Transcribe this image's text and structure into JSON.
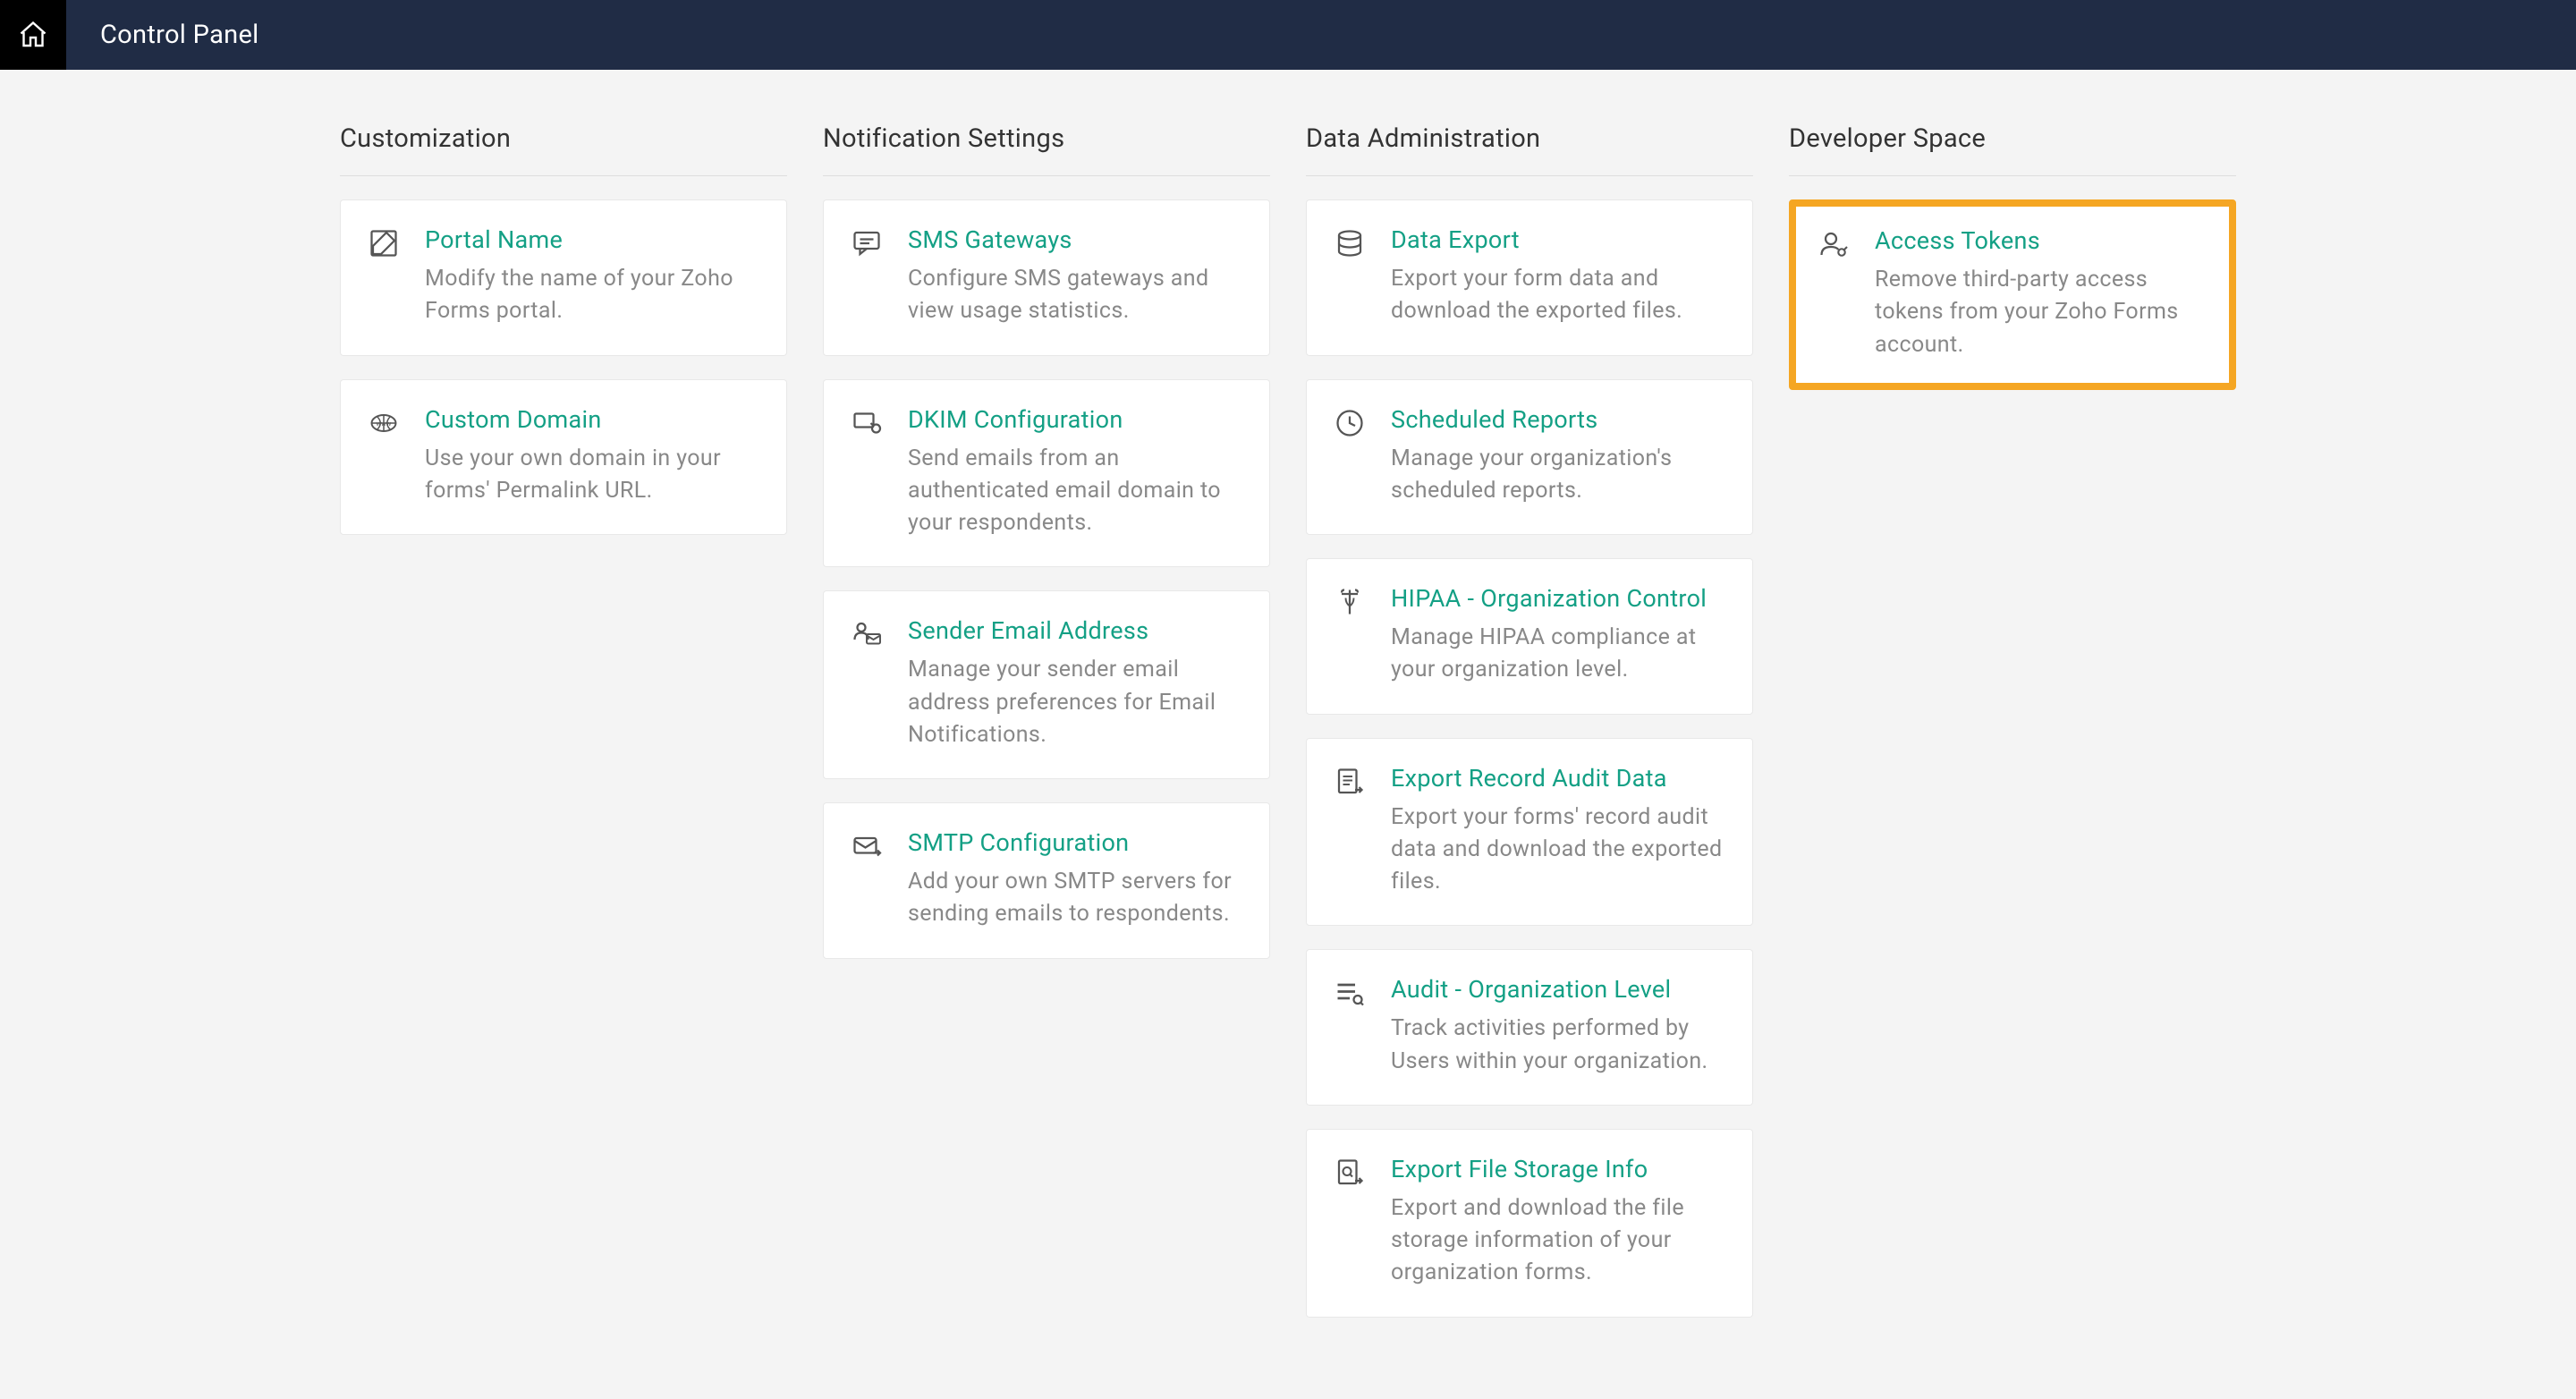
{
  "header": {
    "title": "Control Panel"
  },
  "sections": [
    {
      "title": "Customization",
      "cards": [
        {
          "icon": "edit-icon",
          "title": "Portal Name",
          "desc": "Modify the name of your Zoho Forms portal."
        },
        {
          "icon": "globe-icon",
          "title": "Custom Domain",
          "desc": "Use your own domain in your forms' Permalink URL."
        }
      ]
    },
    {
      "title": "Notification Settings",
      "cards": [
        {
          "icon": "chat-icon",
          "title": "SMS Gateways",
          "desc": "Configure SMS gateways and view usage statistics."
        },
        {
          "icon": "key-icon",
          "title": "DKIM Configuration",
          "desc": "Send emails from an authenticated email domain to your respondents."
        },
        {
          "icon": "mail-user-icon",
          "title": "Sender Email Address",
          "desc": "Manage your sender email address preferences for Email Notifications."
        },
        {
          "icon": "mail-send-icon",
          "title": "SMTP Configuration",
          "desc": "Add your own SMTP servers for sending emails to respondents."
        }
      ]
    },
    {
      "title": "Data Administration",
      "cards": [
        {
          "icon": "database-icon",
          "title": "Data Export",
          "desc": "Export your form data and download the exported files."
        },
        {
          "icon": "clock-icon",
          "title": "Scheduled Reports",
          "desc": "Manage your organization's scheduled reports."
        },
        {
          "icon": "medical-icon",
          "title": "HIPAA - Organization Control",
          "desc": "Manage HIPAA compliance at your organization level."
        },
        {
          "icon": "doc-export-icon",
          "title": "Export Record Audit Data",
          "desc": "Export your forms' record audit data and download the exported files."
        },
        {
          "icon": "list-search-icon",
          "title": "Audit - Organization Level",
          "desc": "Track activities performed by Users within your organization."
        },
        {
          "icon": "doc-search-icon",
          "title": "Export File Storage Info",
          "desc": "Export and download the file storage information of your organization forms."
        }
      ]
    },
    {
      "title": "Developer Space",
      "cards": [
        {
          "icon": "user-key-icon",
          "title": "Access Tokens",
          "desc": "Remove third-party access tokens from your Zoho Forms account.",
          "highlight": true
        }
      ]
    }
  ]
}
